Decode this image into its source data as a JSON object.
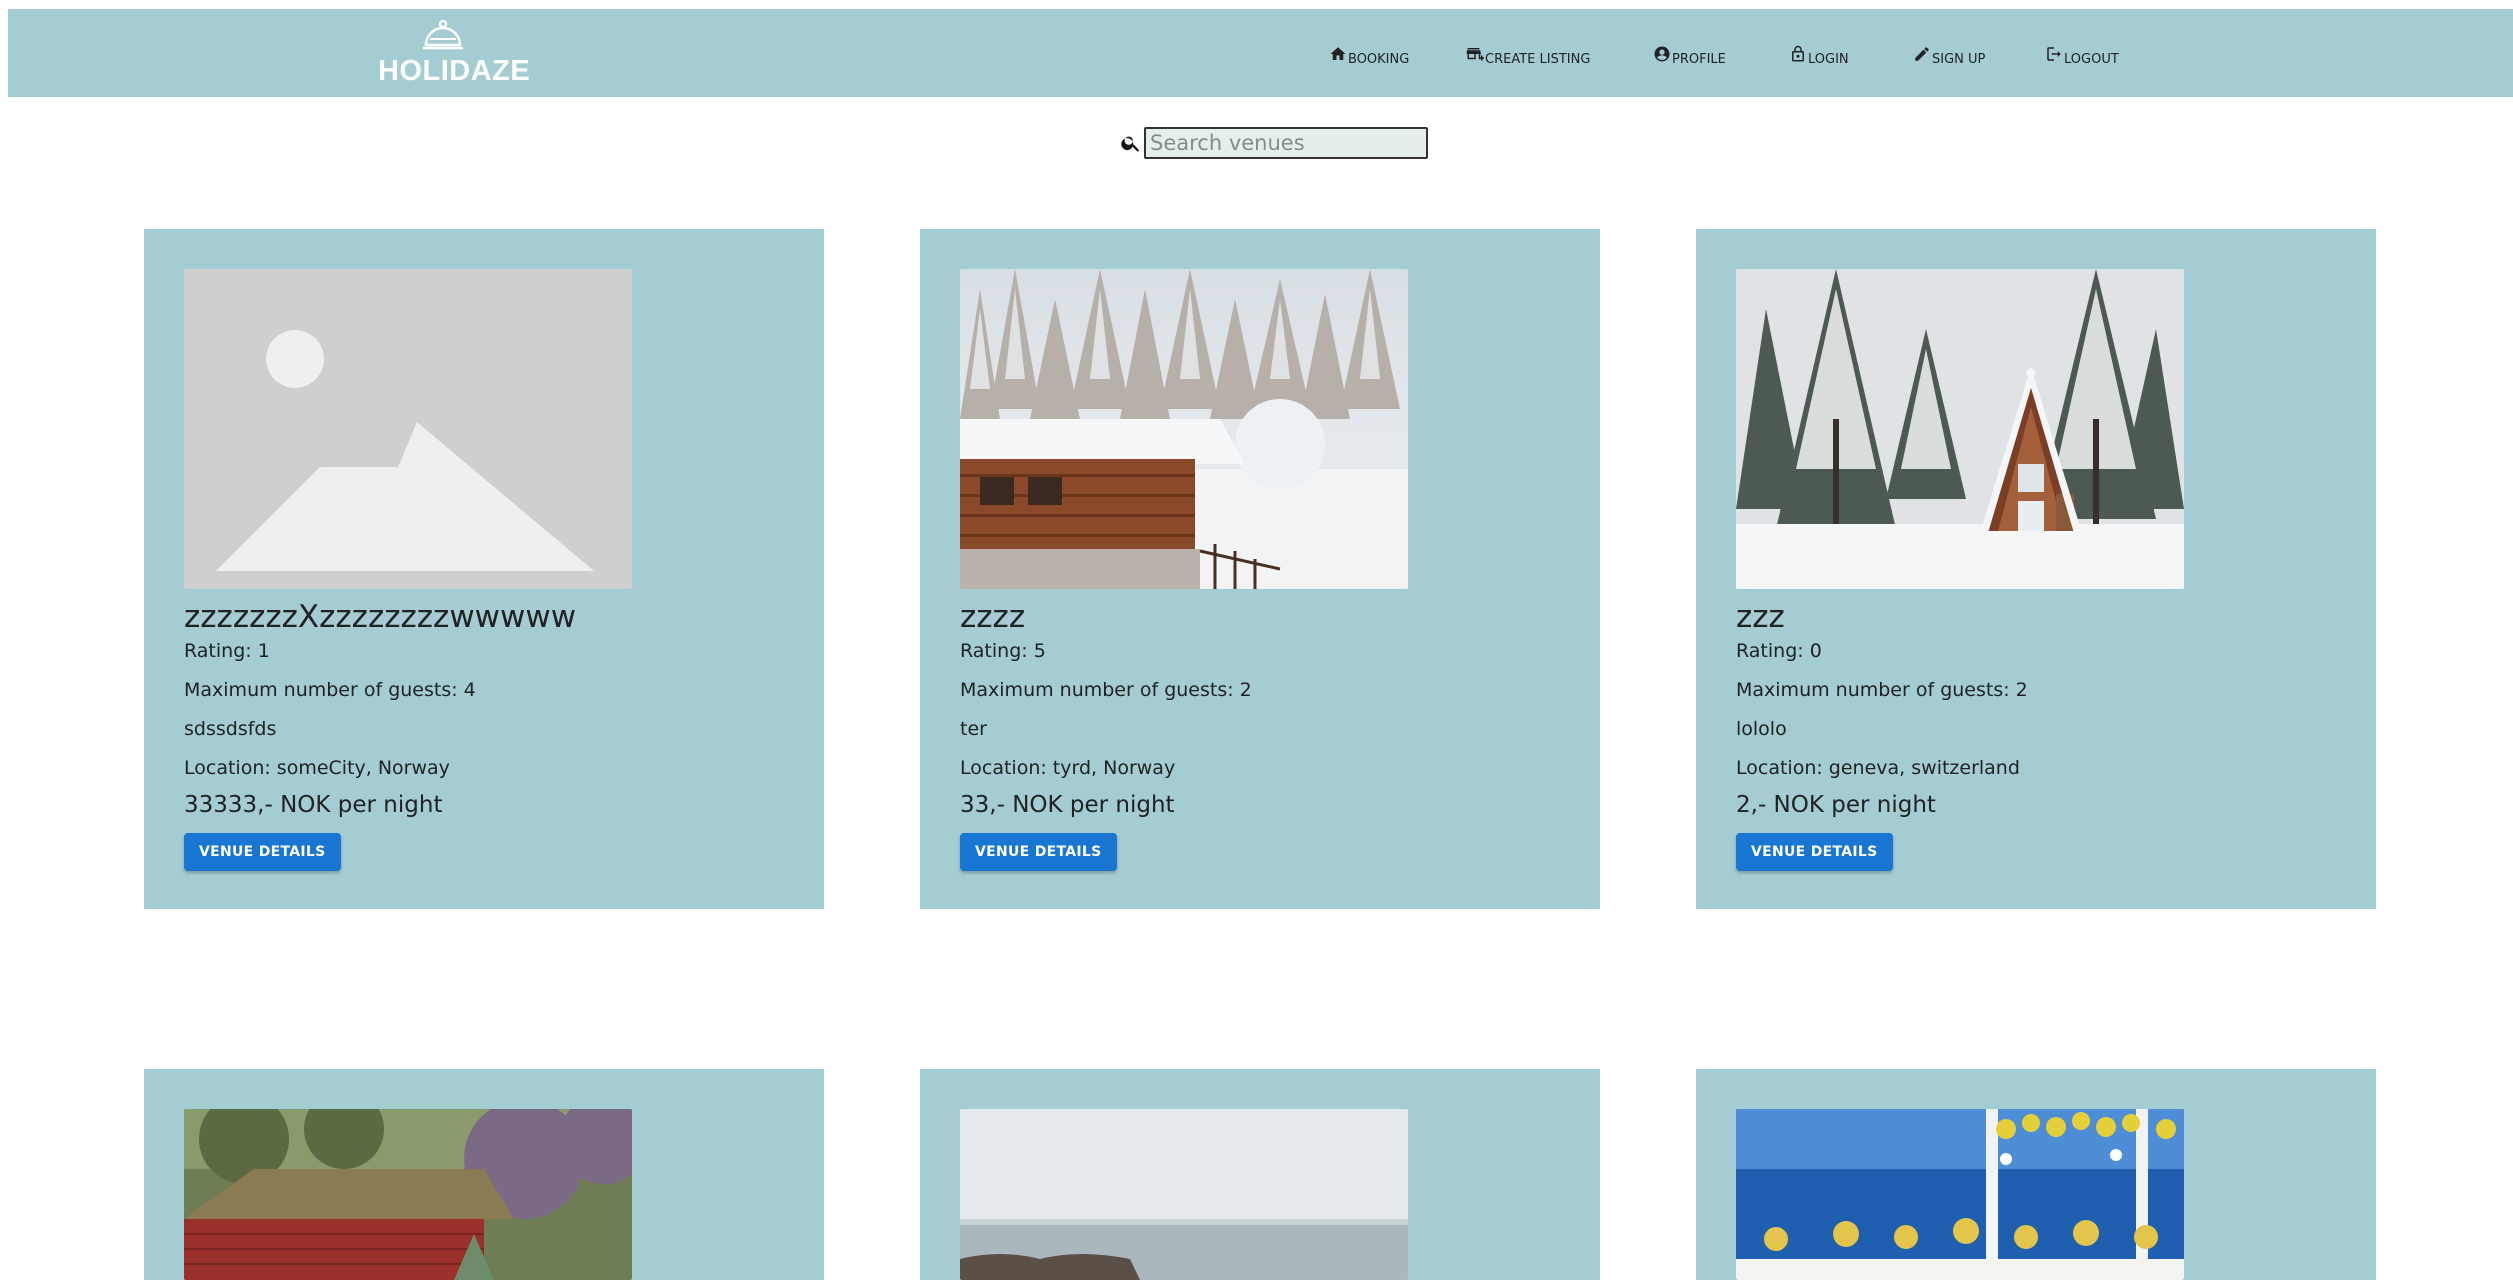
{
  "brand": {
    "name": "HOLIDAZE"
  },
  "nav": [
    {
      "label": "BOOKING",
      "icon": "home-icon"
    },
    {
      "label": "CREATE LISTING",
      "icon": "storefront-add-icon"
    },
    {
      "label": "PROFILE",
      "icon": "account-circle-icon"
    },
    {
      "label": "LOGIN",
      "icon": "lock-icon"
    },
    {
      "label": "SIGN UP",
      "icon": "pencil-icon"
    },
    {
      "label": "LOGOUT",
      "icon": "logout-icon"
    }
  ],
  "search": {
    "placeholder": "Search venues",
    "icon": "search-icon"
  },
  "colors": {
    "navbar": "#a3cdd3",
    "card": "#a3cdd3",
    "button": "#1976d2"
  },
  "venues": [
    {
      "name": "zzzzzzzXzzzzzzzzwwwww",
      "rating": "Rating: 1",
      "guests": "Maximum number of guests: 4",
      "description": "sdssdsfds",
      "location": "Location: someCity, Norway",
      "price": "33333,- NOK per night",
      "button": "VENUE DETAILS",
      "image": "placeholder-image-icon"
    },
    {
      "name": "zzzz",
      "rating": "Rating: 5",
      "guests": "Maximum number of guests: 2",
      "description": "ter",
      "location": "Location: tyrd, Norway",
      "price": "33,- NOK per night",
      "button": "VENUE DETAILS",
      "image": "snowy-cabin-photo"
    },
    {
      "name": "zzz",
      "rating": "Rating: 0",
      "guests": "Maximum number of guests: 2",
      "description": "lololo",
      "location": "Location: geneva, switzerland",
      "price": "2,- NOK per night",
      "button": "VENUE DETAILS",
      "image": "a-frame-cabin-photo"
    },
    {
      "image": "thatched-red-house-photo"
    },
    {
      "image": "rocky-sea-shore-photo"
    },
    {
      "image": "seaside-wedding-table-photo"
    }
  ]
}
